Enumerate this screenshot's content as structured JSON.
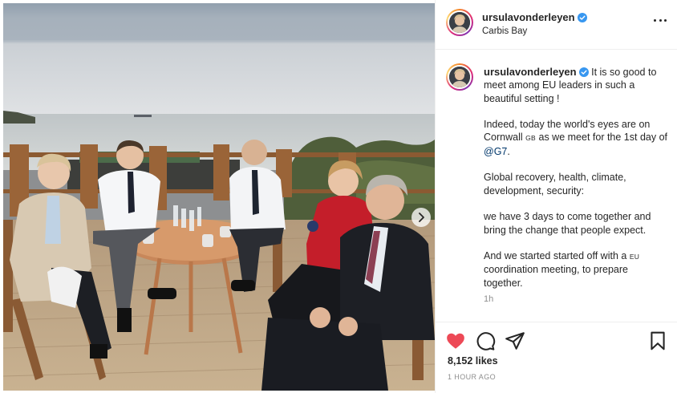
{
  "post": {
    "author": {
      "username": "ursulavonderleyen",
      "location": "Carbis Bay",
      "verified": true
    },
    "caption": {
      "username": "ursulavonderleyen",
      "paragraph_1": "It is so good to meet among EU leaders in such a beautiful setting !",
      "p2_a": "Indeed, today the world's eyes are on Cornwall",
      "p2_gb": "GB",
      "p2_b": "as we meet for the 1st day of",
      "p2_mention": "@G7",
      "p2_c": ".",
      "paragraph_3": "Global recovery, health, climate, development, security:",
      "paragraph_4": "we have 3 days to come together and bring the change that people expect.",
      "p5_a": "And we started started off with a",
      "p5_eu": "EU",
      "p5_b": "coordination meeting, to prepare together.",
      "posted_relative": "1h"
    },
    "likes": "8,152 likes",
    "timestamp": "1 HOUR AGO",
    "icons": {
      "like": "heart-filled-icon",
      "comment": "comment-bubble-icon",
      "share": "paper-plane-icon",
      "save": "bookmark-icon",
      "more": "more-dots-icon",
      "next": "chevron-right-icon"
    },
    "colors": {
      "like_red": "#ed4956",
      "verified_blue": "#3897f0",
      "mention_blue": "#00376b",
      "muted_gray": "#8e8e8e"
    }
  }
}
